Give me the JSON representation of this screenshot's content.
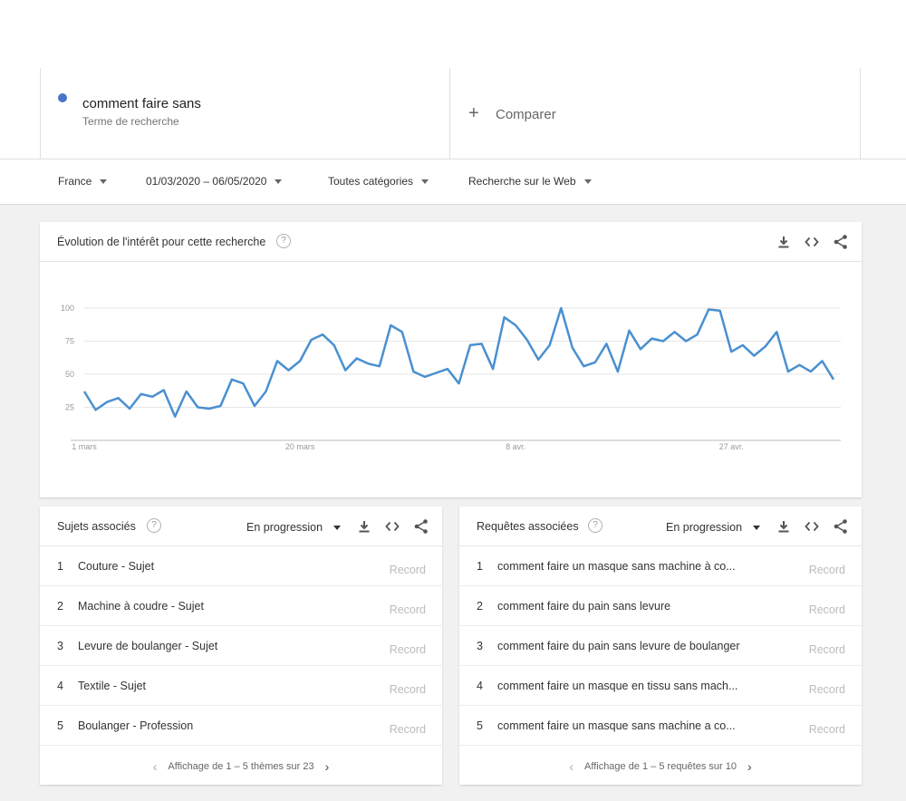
{
  "search": {
    "term": "comment faire sans",
    "term_type": "Terme de recherche",
    "term_color": "#4a74c9",
    "compare_label": "Comparer"
  },
  "filters": {
    "region": "France",
    "date_range": "01/03/2020 – 06/05/2020",
    "category": "Toutes catégories",
    "search_type": "Recherche sur le Web"
  },
  "interest": {
    "title": "Évolution de l'intérêt pour cette recherche"
  },
  "chart_data": {
    "type": "line",
    "x_tick_labels": [
      "1 mars",
      "20 mars",
      "8 avr.",
      "27 avr."
    ],
    "y_ticks": [
      25,
      50,
      75,
      100
    ],
    "ylim": [
      0,
      100
    ],
    "grid": true,
    "series": [
      {
        "color": "#4a90d0",
        "values": [
          37,
          23,
          29,
          32,
          24,
          35,
          33,
          38,
          18,
          37,
          25,
          24,
          26,
          46,
          43,
          26,
          37,
          60,
          53,
          60,
          76,
          80,
          72,
          53,
          62,
          58,
          56,
          87,
          82,
          52,
          48,
          51,
          54,
          43,
          72,
          73,
          54,
          93,
          87,
          76,
          61,
          72,
          100,
          70,
          56,
          59,
          73,
          52,
          83,
          69,
          77,
          75,
          82,
          75,
          80,
          99,
          98,
          67,
          72,
          64,
          71,
          82,
          52,
          57,
          52,
          60,
          46
        ]
      }
    ]
  },
  "topics": {
    "title": "Sujets associés",
    "mode": "En progression",
    "items": [
      {
        "rank": "1",
        "label": "Couture - Sujet",
        "value": "Record"
      },
      {
        "rank": "2",
        "label": "Machine à coudre - Sujet",
        "value": "Record"
      },
      {
        "rank": "3",
        "label": "Levure de boulanger - Sujet",
        "value": "Record"
      },
      {
        "rank": "4",
        "label": "Textile - Sujet",
        "value": "Record"
      },
      {
        "rank": "5",
        "label": "Boulanger - Profession",
        "value": "Record"
      }
    ],
    "pager": "Affichage de 1 – 5 thèmes sur 23"
  },
  "queries": {
    "title": "Requêtes associées",
    "mode": "En progression",
    "items": [
      {
        "rank": "1",
        "label": "comment faire un masque sans machine à co...",
        "value": "Record"
      },
      {
        "rank": "2",
        "label": "comment faire du pain sans levure",
        "value": "Record"
      },
      {
        "rank": "3",
        "label": "comment faire du pain sans levure de boulanger",
        "value": "Record"
      },
      {
        "rank": "4",
        "label": "comment faire un masque en tissu sans mach...",
        "value": "Record"
      },
      {
        "rank": "5",
        "label": "comment faire un masque sans machine a co...",
        "value": "Record"
      }
    ],
    "pager": "Affichage de 1 – 5 requêtes sur 10"
  }
}
